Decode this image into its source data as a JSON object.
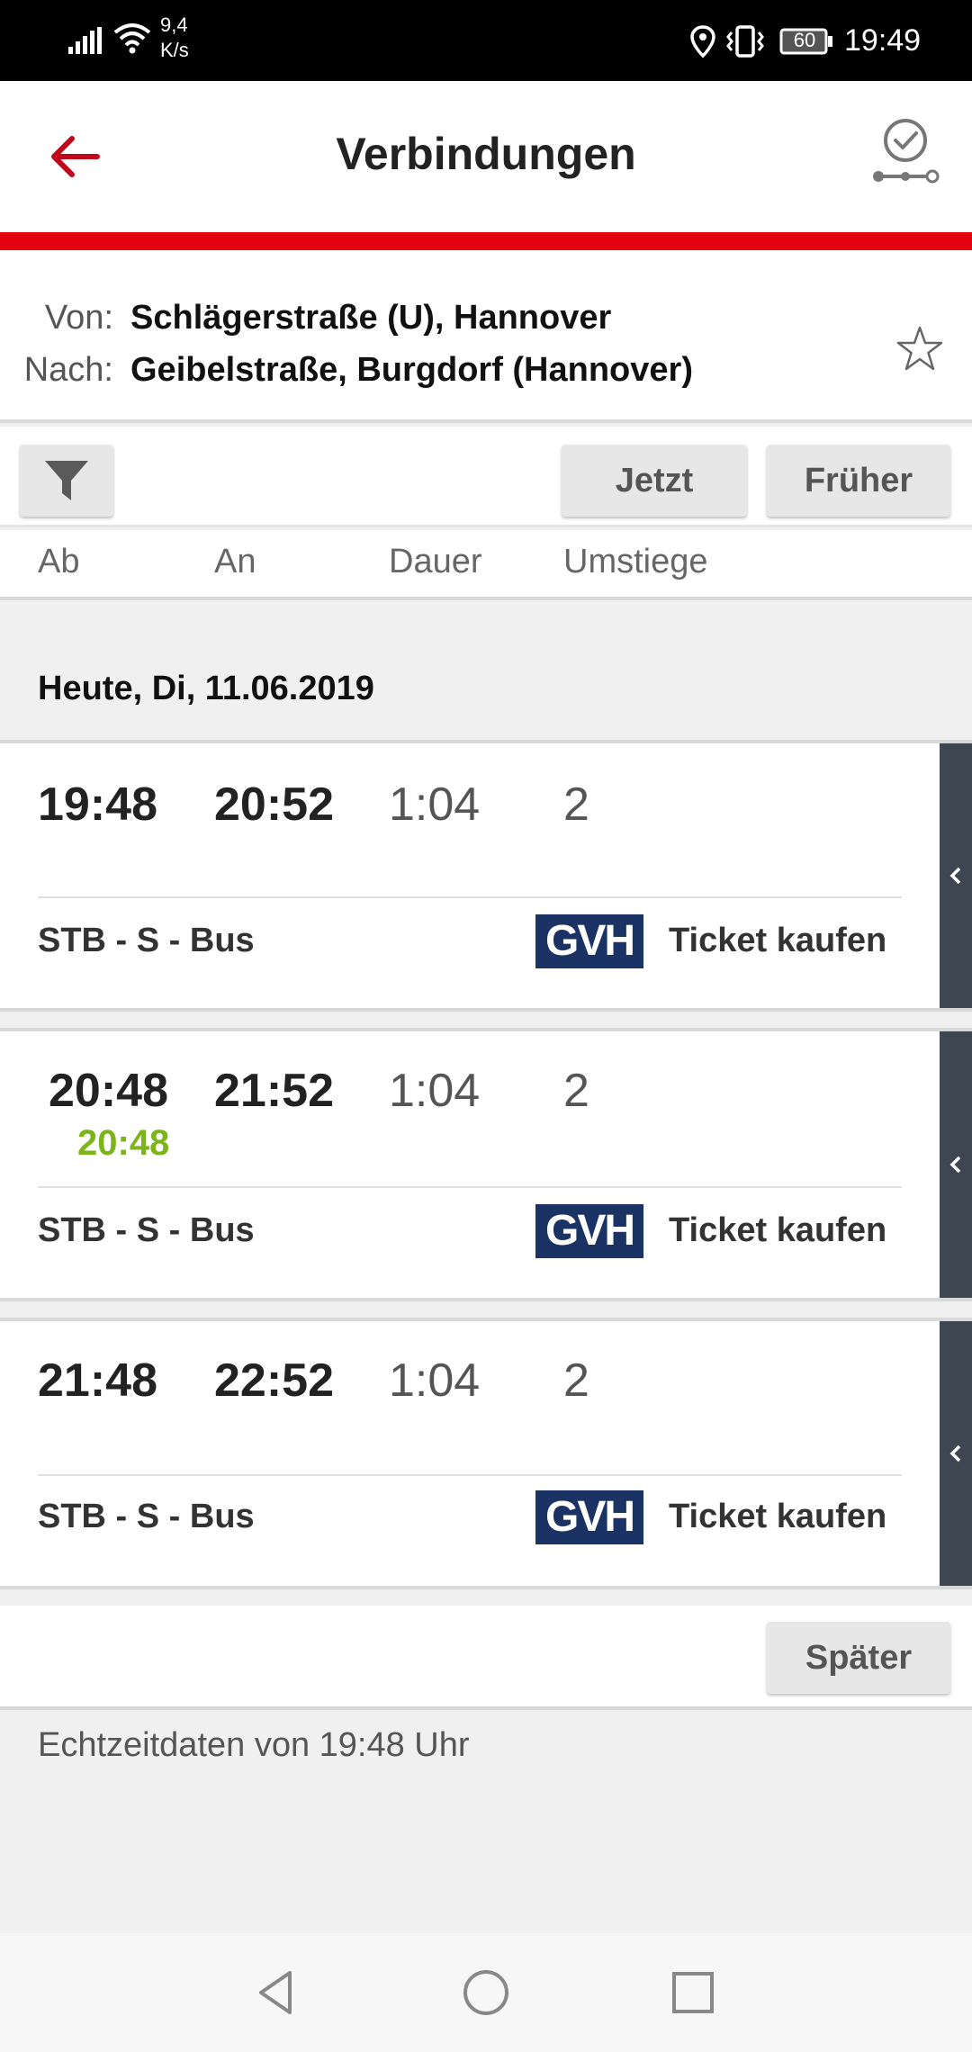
{
  "status_bar": {
    "net_speed": "9,4 K/s",
    "battery": "60",
    "time": "19:49"
  },
  "header": {
    "title": "Verbindungen"
  },
  "route": {
    "from_label": "Von:",
    "from": "Schlägerstraße (U), Hannover",
    "to_label": "Nach:",
    "to": "Geibelstraße, Burgdorf (Hannover)"
  },
  "toolbar": {
    "now_label": "Jetzt",
    "earlier_label": "Früher"
  },
  "columns": [
    "Ab",
    "An",
    "Dauer",
    "Umstiege"
  ],
  "date_heading": "Heute, Di, 11.06.2019",
  "connections": [
    {
      "departure": "19:48",
      "arrival": "20:52",
      "duration": "1:04",
      "changes": "2",
      "realtime": "",
      "products": "STB - S - Bus",
      "operator": "GVH",
      "ticket_label": "Ticket kaufen"
    },
    {
      "departure": "20:48",
      "arrival": "21:52",
      "duration": "1:04",
      "changes": "2",
      "realtime": "20:48",
      "products": "STB - S - Bus",
      "operator": "GVH",
      "ticket_label": "Ticket kaufen"
    },
    {
      "departure": "21:48",
      "arrival": "22:52",
      "duration": "1:04",
      "changes": "2",
      "realtime": "",
      "products": "STB - S - Bus",
      "operator": "GVH",
      "ticket_label": "Ticket kaufen"
    }
  ],
  "later_label": "Später",
  "footer_note": "Echtzeitdaten von 19:48 Uhr",
  "colors": {
    "brand_red": "#e3000f",
    "realtime_green": "#7cb518",
    "gvh_blue": "#1b3264",
    "expand_bar": "#3e4651"
  }
}
